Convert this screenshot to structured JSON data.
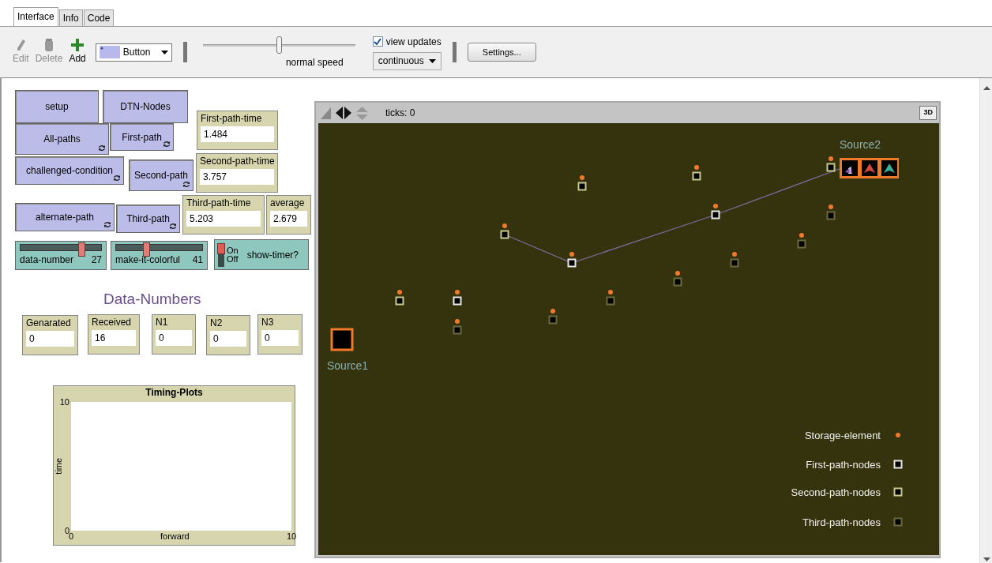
{
  "tabs": [
    {
      "label": "Interface",
      "selected": true
    },
    {
      "label": "Info",
      "selected": false
    },
    {
      "label": "Code",
      "selected": false
    }
  ],
  "toolbar": {
    "tools": [
      {
        "label": "Edit",
        "disabled": true,
        "kind": "pencil"
      },
      {
        "label": "Delete",
        "disabled": true,
        "kind": "trash"
      },
      {
        "label": "Add",
        "disabled": false,
        "kind": "plus"
      }
    ],
    "widget_type": "Button",
    "speed": {
      "label": "normal speed",
      "level": 0.5
    },
    "view_updates": {
      "label": "view updates",
      "checked": true
    },
    "update_mode": "continuous",
    "settings": "Settings..."
  },
  "buttons": [
    {
      "label": "setup",
      "forever": false
    },
    {
      "label": "DTN-Nodes",
      "forever": false
    },
    {
      "label": "All-paths",
      "forever": true
    },
    {
      "label": "First-path",
      "forever": true
    },
    {
      "label": "challenged-condition",
      "forever": true
    },
    {
      "label": "Second-path",
      "forever": true
    },
    {
      "label": "alternate-path",
      "forever": true
    },
    {
      "label": "Third-path",
      "forever": true
    }
  ],
  "monitors": [
    {
      "label": "First-path-time",
      "value": "1.484"
    },
    {
      "label": "Second-path-time",
      "value": "3.757"
    },
    {
      "label": "Third-path-time",
      "value": "5.203"
    },
    {
      "label": "average",
      "value": "2.679"
    },
    {
      "label": "Genarated",
      "value": "0"
    },
    {
      "label": "Received",
      "value": "16"
    },
    {
      "label": "N1",
      "value": "0"
    },
    {
      "label": "N2",
      "value": "0"
    },
    {
      "label": "N3",
      "value": "0"
    }
  ],
  "sliders": [
    {
      "label": "data-number",
      "value": "27",
      "level": 0.75
    },
    {
      "label": "make-it-colorful",
      "value": "41",
      "level": 0.35
    }
  ],
  "switch": {
    "label": "show-timer?",
    "on_text": "On",
    "off_text": "Off",
    "on": true
  },
  "note": "Data-Numbers",
  "plot": {
    "chart_data": {
      "type": "line",
      "title": "Timing-Plots",
      "xlabel": "forward",
      "ylabel": "time",
      "xlim": [
        0,
        10
      ],
      "ylim": [
        0,
        10
      ],
      "xticks": [
        0,
        10
      ],
      "yticks": [
        0,
        10
      ]
    }
  },
  "view": {
    "ticks": "ticks: 0",
    "three_d": "3D",
    "source1": "Source1",
    "source2": "Source2",
    "turtle_label": "1",
    "nodes": [
      {
        "kind": "second"
      },
      {
        "kind": "first"
      },
      {
        "kind": "third"
      },
      {
        "kind": "second"
      },
      {
        "kind": "first"
      },
      {
        "kind": "third"
      },
      {
        "kind": "second"
      },
      {
        "kind": "third"
      },
      {
        "kind": "second"
      },
      {
        "kind": "first"
      },
      {
        "kind": "second"
      },
      {
        "kind": "third"
      },
      {
        "kind": "third"
      },
      {
        "kind": "third"
      },
      {
        "kind": "third"
      }
    ],
    "legend": [
      {
        "label": "Storage-element",
        "kind": "storage"
      },
      {
        "label": "First-path-nodes",
        "kind": "first"
      },
      {
        "label": "Second-path-nodes",
        "kind": "second"
      },
      {
        "label": "Third-path-nodes",
        "kind": "third"
      }
    ]
  }
}
